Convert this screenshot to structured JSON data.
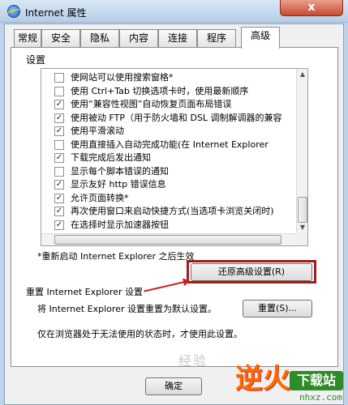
{
  "window": {
    "title": "Internet 属性",
    "close_glyph": "x"
  },
  "tabs": [
    {
      "label": "常规"
    },
    {
      "label": "安全"
    },
    {
      "label": "隐私"
    },
    {
      "label": "内容"
    },
    {
      "label": "连接"
    },
    {
      "label": "程序"
    },
    {
      "label": "高级"
    }
  ],
  "active_tab": "高级",
  "settings": {
    "title": "设置",
    "items": [
      {
        "label": "使网站可以使用搜索窗格*",
        "checked": false
      },
      {
        "label": "使用 Ctrl+Tab 切换选项卡时，使用最新顺序",
        "checked": false
      },
      {
        "label": "使用“兼容性视图”自动恢复页面布局错误",
        "checked": true
      },
      {
        "label": "使用被动 FTP（用于防火墙和 DSL 调制解调器的兼容",
        "checked": true
      },
      {
        "label": "使用平滑滚动",
        "checked": true
      },
      {
        "label": "使用直接插入自动完成功能(在 Internet Explorer",
        "checked": false
      },
      {
        "label": "下载完成后发出通知",
        "checked": true
      },
      {
        "label": "显示每个脚本错误的通知",
        "checked": false
      },
      {
        "label": "显示友好 http 错误信息",
        "checked": true
      },
      {
        "label": "允许页面转换*",
        "checked": true
      },
      {
        "label": "再次使用窗口来启动快捷方式(当选项卡浏览关闭时)",
        "checked": true
      },
      {
        "label": "在选择时显示加速器按钮",
        "checked": true
      }
    ],
    "restart_note": "*重新启动 Internet Explorer 之后生效",
    "restore_button": "还原高级设置(R)"
  },
  "reset": {
    "heading": "重置 Internet Explorer 设置",
    "description": "将 Internet Explorer 设置重置为默认设置。",
    "button": "重置(S)...",
    "note": "仅在浏览器处于无法使用的状态时，才使用此设置。"
  },
  "footer": {
    "ok_button": "确定"
  },
  "overlay": {
    "watermark": "经验",
    "logo_text": "逆火",
    "logo_badge": "下载站",
    "logo_url": "nhxz.com"
  },
  "colors": {
    "highlight": "#a31b1b",
    "logo_orange": "#ff6a00",
    "logo_green": "#2f8a2a"
  }
}
